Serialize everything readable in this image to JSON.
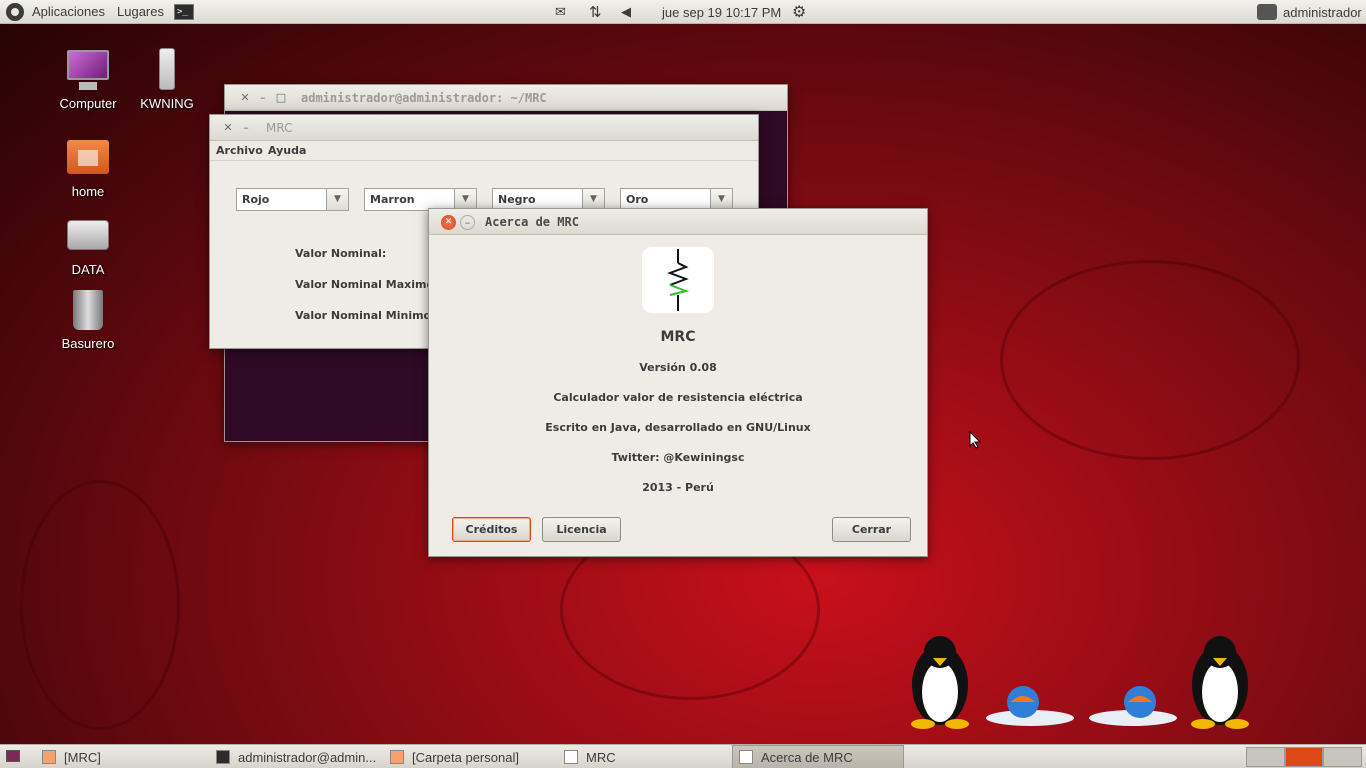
{
  "top_panel": {
    "menu_apps": "Aplicaciones",
    "menu_places": "Lugares",
    "clock": "jue sep 19 10:17 PM",
    "user": "administrador"
  },
  "desktop_icons": [
    {
      "label": "Computer",
      "icon": "computer-icon"
    },
    {
      "label": "KWNING",
      "icon": "usb-drive-icon"
    },
    {
      "label": "home",
      "icon": "home-folder-icon"
    },
    {
      "label": "DATA",
      "icon": "hard-drive-icon"
    },
    {
      "label": "Basurero",
      "icon": "trash-icon"
    }
  ],
  "terminal_window": {
    "title": "administrador@administrador: ~/MRC"
  },
  "mrc_window": {
    "title": "MRC",
    "menu": [
      "Archivo",
      "Ayuda"
    ],
    "combos": [
      "Rojo",
      "Marron",
      "Negro",
      "Oro"
    ],
    "labels": [
      "Valor Nominal:",
      "Valor Nominal Maximo:",
      "Valor Nominal Minimo:"
    ]
  },
  "about_dialog": {
    "title": "Acerca de MRC",
    "app_name": "MRC",
    "version": "Versión 0.08",
    "description": "Calculador valor de resistencia eléctrica",
    "written": "Escrito en Java, desarrollado en GNU/Linux",
    "twitter": "Twitter: @Kewiningsc",
    "copyright": "2013 - Perú",
    "buttons": {
      "credits": "Créditos",
      "license": "Licencia",
      "close": "Cerrar"
    }
  },
  "taskbar": [
    {
      "label": "[MRC]",
      "active": false
    },
    {
      "label": "administrador@admin...",
      "active": false
    },
    {
      "label": "[Carpeta personal]",
      "active": false
    },
    {
      "label": "MRC",
      "active": false
    },
    {
      "label": "Acerca de MRC",
      "active": true
    }
  ],
  "colors": {
    "accent": "#dd4814",
    "panel": "#e3e1db",
    "desktop": "#a00d16"
  }
}
